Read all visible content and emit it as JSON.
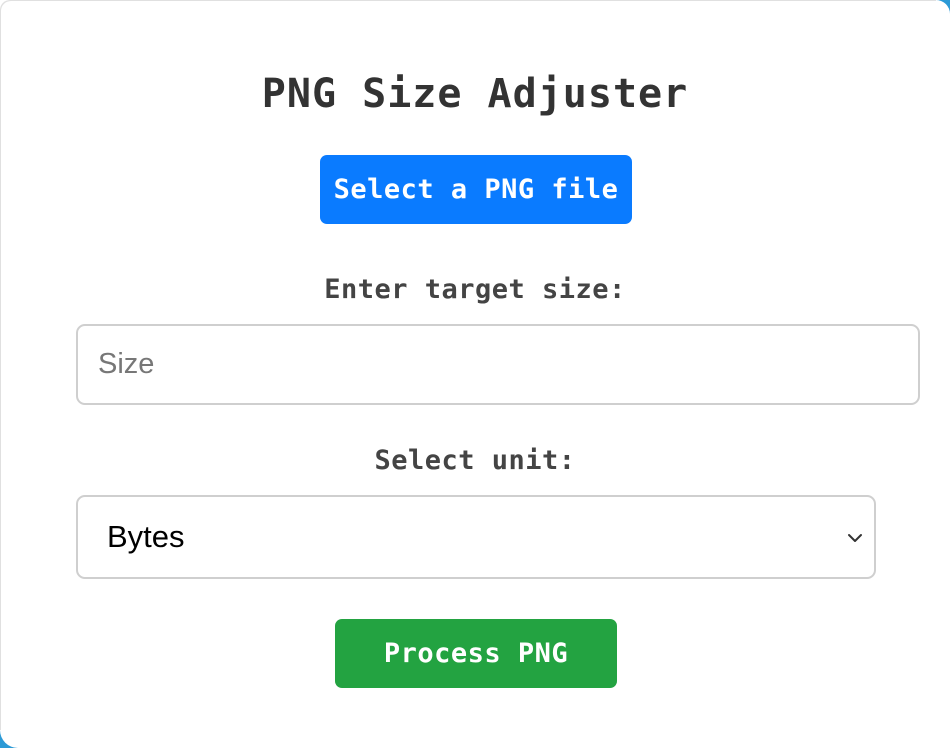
{
  "app": {
    "title": "PNG Size Adjuster"
  },
  "file_picker": {
    "button_label": "Select a PNG file"
  },
  "target_size": {
    "label": "Enter target size:",
    "placeholder": "Size",
    "value": ""
  },
  "unit": {
    "label": "Select unit:",
    "selected": "Bytes",
    "icon": "chevron-down-icon"
  },
  "actions": {
    "process_label": "Process PNG"
  },
  "colors": {
    "select_button": "#0a7bff",
    "process_button": "#23a341",
    "window_accent": "#2c9ad6"
  }
}
